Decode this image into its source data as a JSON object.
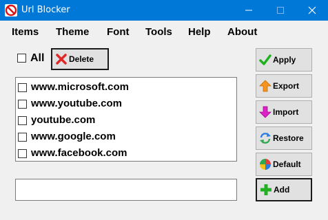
{
  "window": {
    "title": "Url Blocker",
    "titlebar_color": "#0078d7",
    "icons": {
      "app": "no-entry-icon",
      "minimize": "minimize-icon",
      "maximize": "maximize-icon",
      "close": "close-icon"
    }
  },
  "menu": {
    "items": [
      "Items",
      "Theme",
      "Font",
      "Tools",
      "Help",
      "About"
    ]
  },
  "toolbar": {
    "all_label": "All",
    "all_checked": false,
    "delete_label": "Delete",
    "delete_icon": "red-x-icon"
  },
  "url_list": {
    "items": [
      {
        "text": "www.microsoft.com",
        "checked": false
      },
      {
        "text": "www.youtube.com",
        "checked": false
      },
      {
        "text": "youtube.com",
        "checked": false
      },
      {
        "text": "www.google.com",
        "checked": false
      },
      {
        "text": "www.facebook.com",
        "checked": false
      }
    ]
  },
  "url_input": {
    "value": "",
    "placeholder": ""
  },
  "actions": [
    {
      "label": "Apply",
      "icon": "green-check-icon",
      "color": "#1fb11f"
    },
    {
      "label": "Export",
      "icon": "orange-up-arrow-icon",
      "color": "#f7941d"
    },
    {
      "label": "Import",
      "icon": "magenta-down-arrow-icon",
      "color": "#e020c8"
    },
    {
      "label": "Restore",
      "icon": "blue-refresh-icon",
      "color": "#2a7de1"
    },
    {
      "label": "Default",
      "icon": "multicolor-ball-icon",
      "color": "#e04040"
    },
    {
      "label": "Add",
      "icon": "green-plus-icon",
      "color": "#22b022"
    }
  ]
}
